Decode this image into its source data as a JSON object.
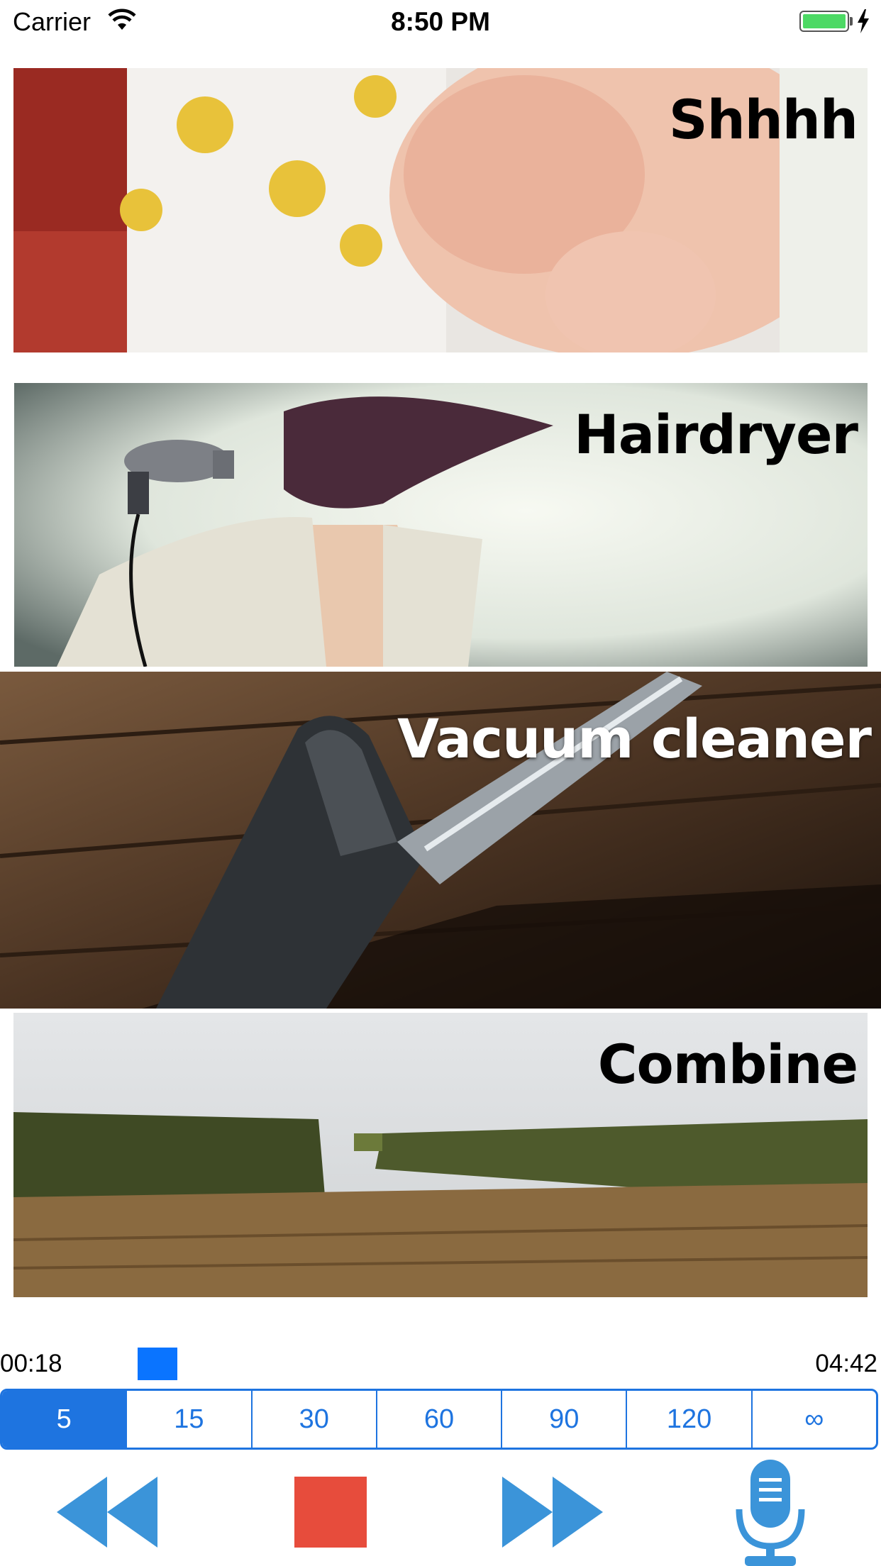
{
  "status_bar": {
    "carrier": "Carrier",
    "time": "8:50 PM",
    "battery_color": "#4cd964"
  },
  "sounds": [
    {
      "title": "Shhhh",
      "icon": "baby-sleeping-image"
    },
    {
      "title": "Hairdryer",
      "icon": "hairdryer-image"
    },
    {
      "title": "Vacuum cleaner",
      "icon": "vacuum-cleaner-image"
    },
    {
      "title": "Combine",
      "icon": "cornfield-combine-image"
    }
  ],
  "player": {
    "elapsed": "00:18",
    "total": "04:42",
    "progress_fraction": 0.064,
    "accent": "#1e74e0"
  },
  "durations": {
    "options": [
      "5",
      "15",
      "30",
      "60",
      "90",
      "120",
      "∞"
    ],
    "selected": "5"
  },
  "controls": {
    "rewind_icon": "rewind-icon",
    "stop_icon": "stop-icon",
    "forward_icon": "fast-forward-icon",
    "mic_icon": "microphone-icon",
    "stop_color": "#e74c3c",
    "button_color": "#3b94d9"
  }
}
